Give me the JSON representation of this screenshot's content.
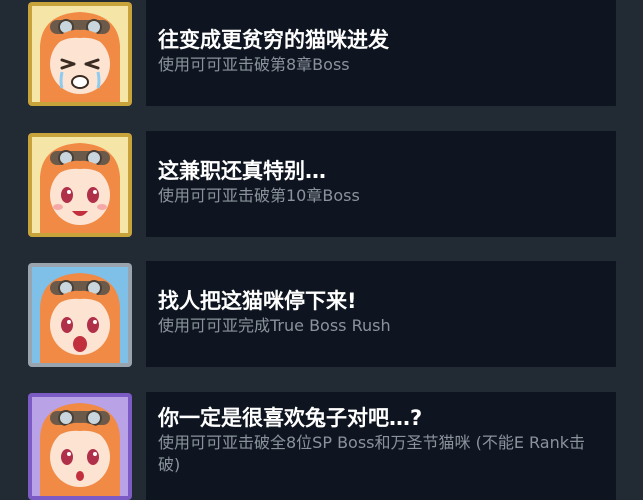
{
  "achievements": [
    {
      "title": "往变成更贫穷的猫咪进发",
      "description": "使用可可亚击破第8章Boss",
      "frame": "gold",
      "expression": "crying",
      "icon": "kokoa-crying-portrait-icon"
    },
    {
      "title": "这兼职还真特别…",
      "description": "使用可可亚击破第10章Boss",
      "frame": "gold",
      "expression": "happy",
      "icon": "kokoa-happy-portrait-icon"
    },
    {
      "title": "找人把这猫咪停下来!",
      "description": "使用可可亚完成True Boss Rush",
      "frame": "silver",
      "expression": "shocked",
      "icon": "kokoa-shocked-portrait-icon"
    },
    {
      "title": "你一定是很喜欢兔子对吧…?",
      "description": "使用可可亚击破全8位SP Boss和万圣节猫咪 (不能E Rank击破)",
      "frame": "purple",
      "expression": "surprised",
      "icon": "kokoa-surprised-portrait-icon"
    }
  ],
  "colors": {
    "background": "#222a33",
    "panel": "#0f1520",
    "title": "#ffffff",
    "description": "#8a929c",
    "gold_frame": "#c8a23a",
    "silver_frame": "#9aa4ae",
    "purple_frame": "#7c5bc4",
    "hair": "#f08a45",
    "eyes": "#b0304a"
  }
}
